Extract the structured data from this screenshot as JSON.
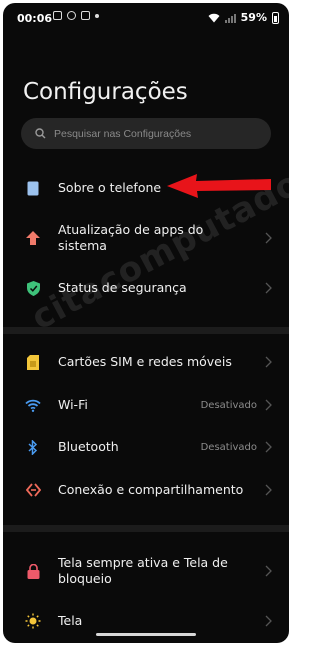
{
  "status_bar": {
    "time": "00:06",
    "battery": "59%"
  },
  "page": {
    "title": "Configurações"
  },
  "search": {
    "placeholder": "Pesquisar nas Configurações"
  },
  "items": [
    {
      "label": "Sobre o telefone",
      "icon": "phone-icon",
      "value": ""
    },
    {
      "label": "Atualização de apps do sistema",
      "icon": "arrow-up-icon",
      "value": ""
    },
    {
      "label": "Status de segurança",
      "icon": "shield-check-icon",
      "value": ""
    },
    {
      "label": "Cartões SIM e redes móveis",
      "icon": "sim-card-icon",
      "value": ""
    },
    {
      "label": "Wi-Fi",
      "icon": "wifi-icon",
      "value": "Desativado"
    },
    {
      "label": "Bluetooth",
      "icon": "bluetooth-icon",
      "value": "Desativado"
    },
    {
      "label": "Conexão e compartilhamento",
      "icon": "connection-icon",
      "value": ""
    },
    {
      "label": "Tela sempre ativa e Tela de bloqueio",
      "icon": "lock-icon",
      "value": ""
    },
    {
      "label": "Tela",
      "icon": "sun-icon",
      "value": ""
    }
  ],
  "watermark": "citacomputadores.com",
  "colors": {
    "background": "#0a0a0a",
    "annotation_arrow": "#e8141a"
  }
}
